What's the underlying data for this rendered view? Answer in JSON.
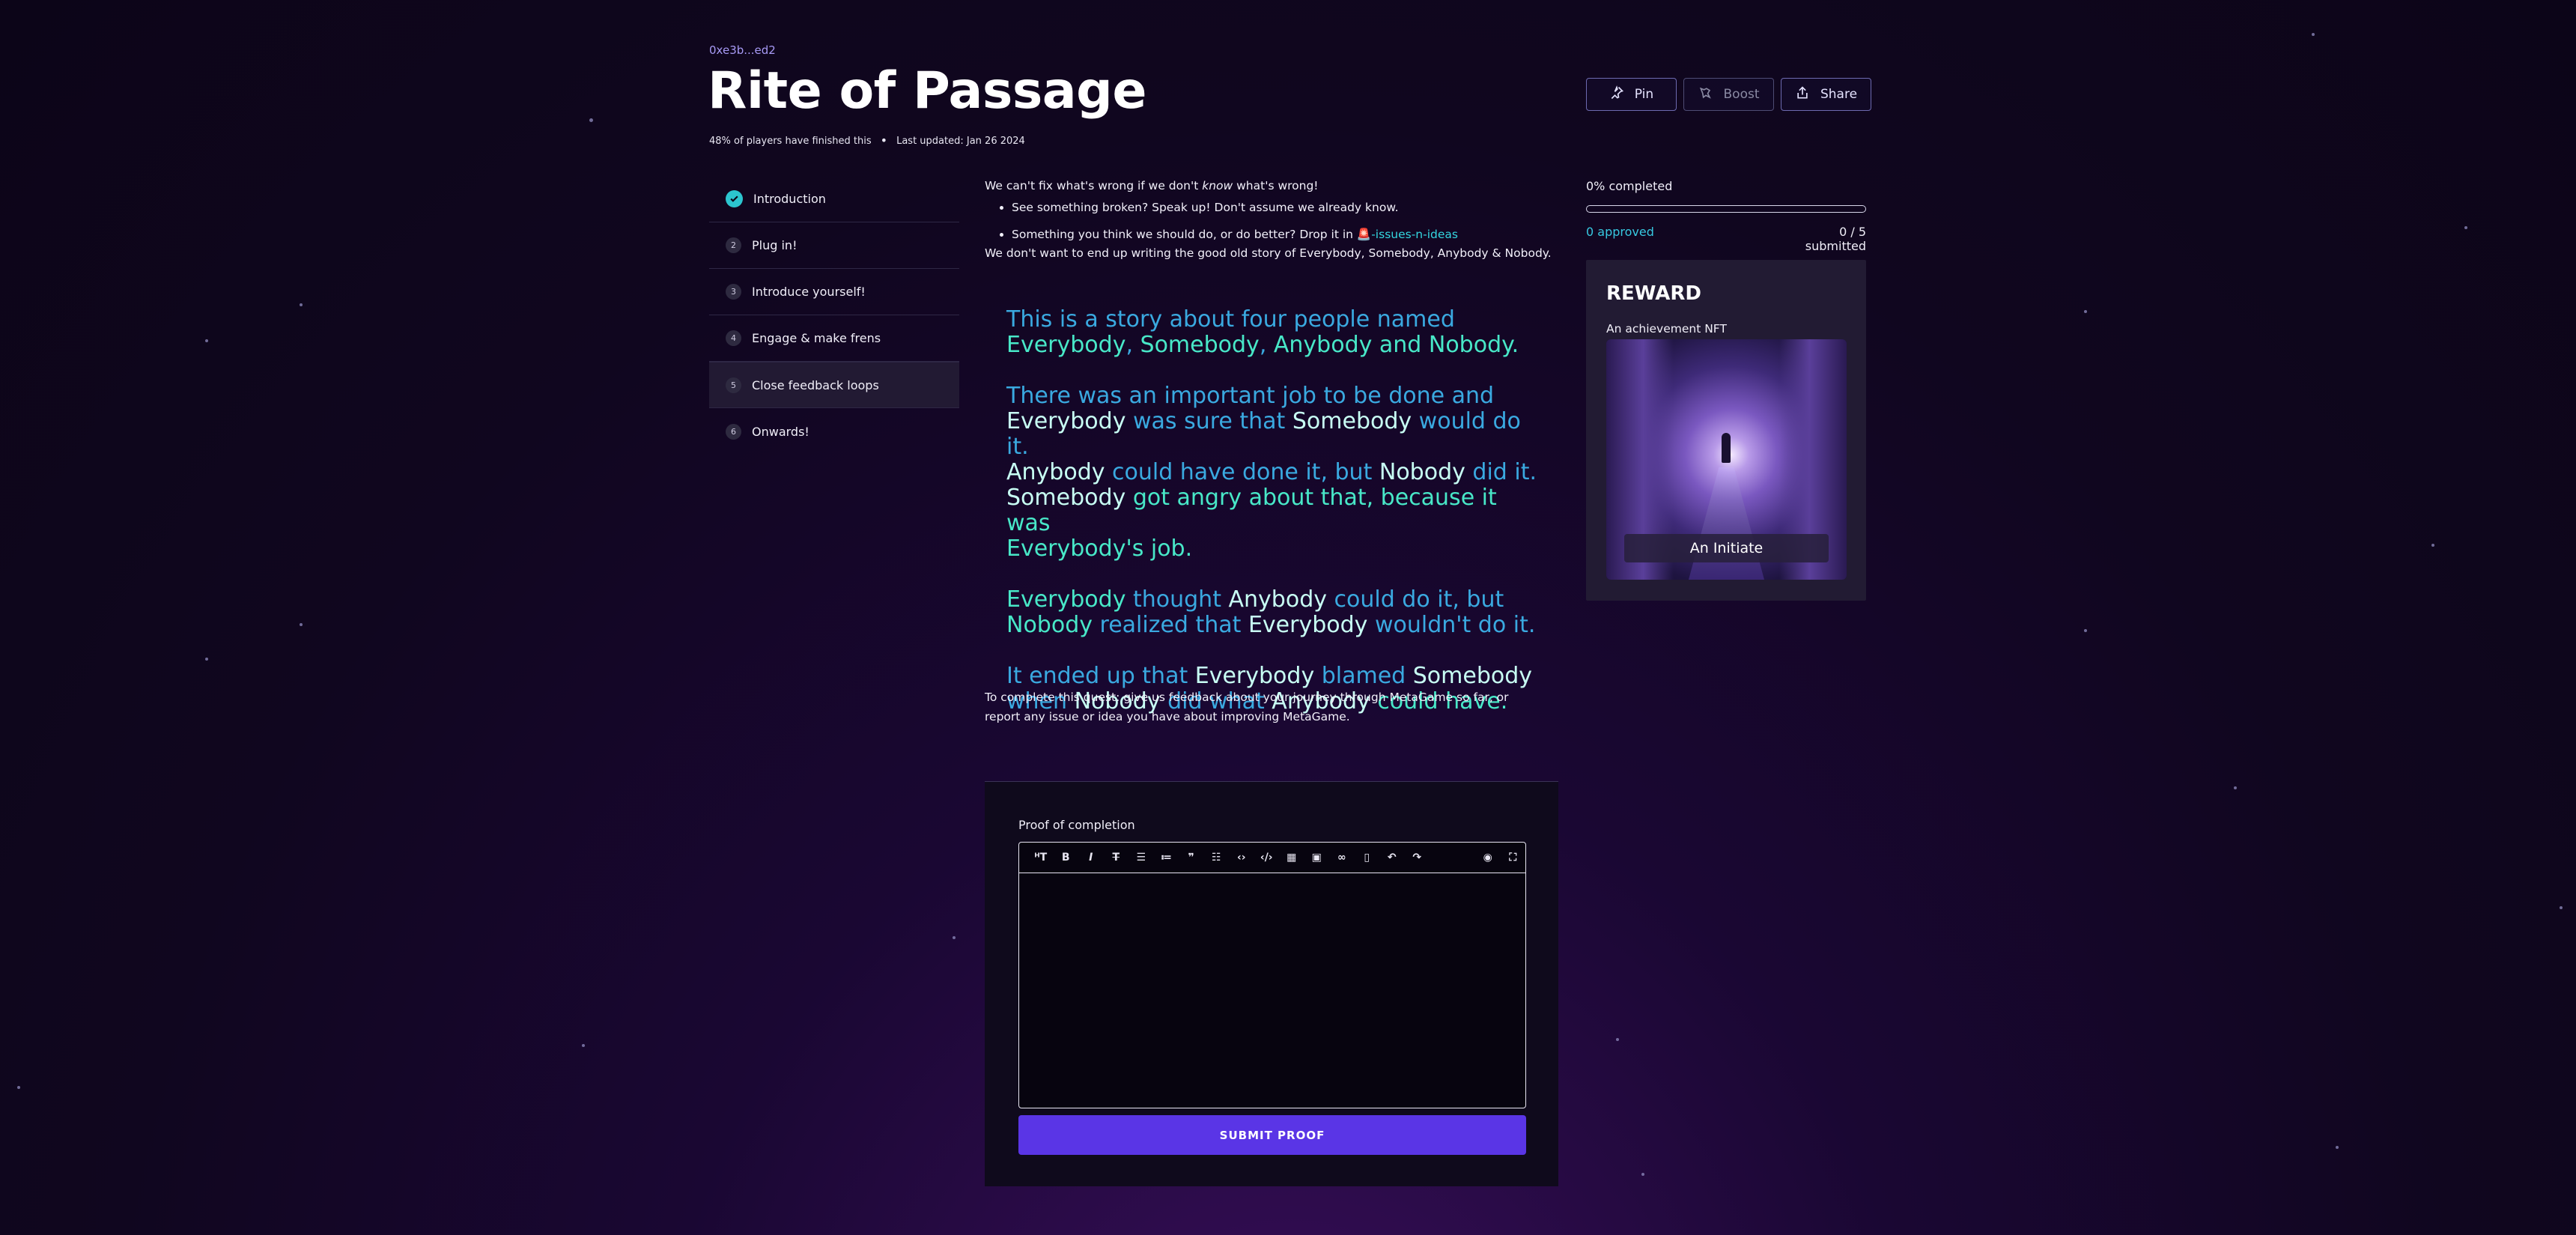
{
  "quest": {
    "owner": "0xe3b...ed2",
    "title": "Rite of Passage",
    "players_finished": "48% of players have finished this",
    "separator": "•",
    "last_updated": "Last updated: Jan 26 2024"
  },
  "actions": {
    "pin": "Pin",
    "boost": "Boost",
    "share": "Share"
  },
  "steps": [
    {
      "num": "1",
      "label": "Introduction"
    },
    {
      "num": "2",
      "label": "Plug in!"
    },
    {
      "num": "3",
      "label": "Introduce yourself!"
    },
    {
      "num": "4",
      "label": "Engage & make frens"
    },
    {
      "num": "5",
      "label": "Close feedback loops"
    },
    {
      "num": "6",
      "label": "Onwards!"
    }
  ],
  "content": {
    "intro_a": "We can't fix what's wrong if we don't ",
    "intro_em": "know",
    "intro_b": " what's wrong!",
    "bullet1": "See something broken? Speak up! Don't assume we already know.",
    "bullet2_a": "Something you think we should do, or do better? Drop it in ",
    "bullet2_emoji": "🚨",
    "bullet2_link": "-issues-n-ideas",
    "paragraph2": "We don't want to end up writing the good old story of Everybody, Somebody, Anybody & Nobody.",
    "complete_text": "To complete this quest: give us feedback about your journey through MetaGame so far, or report any issue or idea you have about improving MetaGame."
  },
  "story": {
    "p1_l1": "This is a story about four people named",
    "p1_l2_a": "Everybody",
    "p1_l2_b": ", ",
    "p1_l2_c": "Somebody",
    "p1_l2_d": ", ",
    "p1_l2_e": "Anybody",
    "p1_l2_f": " and ",
    "p1_l2_g": "Nobody",
    "p1_l2_h": ".",
    "p2_l1": "There was an important job to be done and",
    "p2_l2_a": "Everybody",
    "p2_l2_b": " was sure that ",
    "p2_l2_c": "Somebody",
    "p2_l2_d": " would do it.",
    "p2_l3_a": "Anybody",
    "p2_l3_b": " could have done it, but ",
    "p2_l3_c": "Nobody",
    "p2_l3_d": " did it.",
    "p2_l4_a": "Somebody",
    "p2_l4_b": " got angry about that, because it was",
    "p2_l5_a": "Everybody",
    "p2_l5_b": "'s job.",
    "p3_l1_a": "Everybody",
    "p3_l1_b": " thought ",
    "p3_l1_c": "Anybody",
    "p3_l1_d": " could do it, but",
    "p3_l2_a": "Nobody",
    "p3_l2_b": " realized that ",
    "p3_l2_c": "Everybody",
    "p3_l2_d": " wouldn't do it.",
    "p4_l1_a": "It ended up that ",
    "p4_l1_b": "Everybody",
    "p4_l1_c": " blamed ",
    "p4_l1_d": "Somebody",
    "p4_l2_a": "when ",
    "p4_l2_b": "Nobody",
    "p4_l2_c": " did what ",
    "p4_l2_d": "Anybody",
    "p4_l2_e": " could have."
  },
  "proof": {
    "label": "Proof of completion",
    "submit": "SUBMIT PROOF",
    "toolbar_icons": [
      "heading-icon",
      "bold-icon",
      "italic-icon",
      "strikethrough-icon",
      "unordered-list-icon",
      "ordered-list-icon",
      "quote-icon",
      "checklist-icon",
      "code-icon",
      "code-block-icon",
      "table-icon",
      "image-icon",
      "link-icon",
      "clipboard-icon",
      "undo-icon",
      "redo-icon",
      "preview-icon",
      "fullscreen-icon"
    ]
  },
  "progress": {
    "completed": "0% completed",
    "completed_fraction": 0,
    "approved": "0 approved",
    "submitted": "0 / 5 submitted"
  },
  "reward": {
    "title": "REWARD",
    "subtitle": "An achievement NFT",
    "nft_caption": "An Initiate"
  },
  "colors": {
    "accent": "#5a35e6",
    "link": "#34d7e0",
    "approved": "#37c8e0",
    "check": "#2cc5cf"
  }
}
